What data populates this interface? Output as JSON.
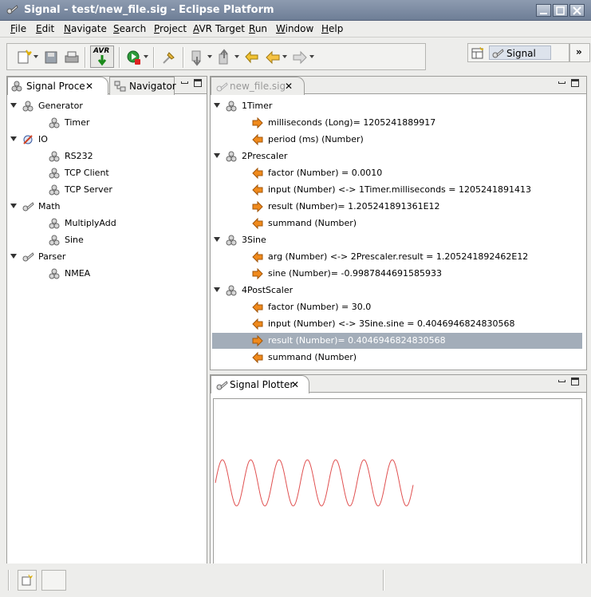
{
  "window": {
    "title": "Signal - test/new_file.sig - Eclipse Platform"
  },
  "menu": [
    "File",
    "Edit",
    "Navigate",
    "Search",
    "Project",
    "AVR Target",
    "Run",
    "Window",
    "Help"
  ],
  "menu_mnemonic": [
    "F",
    "E",
    "N",
    "S",
    "P",
    "A",
    "R",
    "W",
    "H"
  ],
  "toolbar": {
    "avr_label": "AVR"
  },
  "perspective": {
    "label": "Signal"
  },
  "left_panel": {
    "tabs": [
      {
        "label": "Signal Proce"
      },
      {
        "label": "Navigator"
      }
    ],
    "tree": [
      {
        "label": "Generator",
        "level": 0,
        "kind": "group"
      },
      {
        "label": "Timer",
        "level": 1,
        "kind": "component"
      },
      {
        "label": "IO",
        "level": 0,
        "kind": "io"
      },
      {
        "label": "RS232",
        "level": 1,
        "kind": "component"
      },
      {
        "label": "TCP Client",
        "level": 1,
        "kind": "component"
      },
      {
        "label": "TCP Server",
        "level": 1,
        "kind": "component"
      },
      {
        "label": "Math",
        "level": 0,
        "kind": "plug"
      },
      {
        "label": "MultiplyAdd",
        "level": 1,
        "kind": "component"
      },
      {
        "label": "Sine",
        "level": 1,
        "kind": "component"
      },
      {
        "label": "Parser",
        "level": 0,
        "kind": "plug"
      },
      {
        "label": "NMEA",
        "level": 1,
        "kind": "component"
      }
    ]
  },
  "editor": {
    "tab_label": "new_file.sig",
    "tree": [
      {
        "label": "1Timer",
        "level": 0,
        "kind": "group"
      },
      {
        "label": "milliseconds (Long)= 1205241889917",
        "level": 1,
        "kind": "out"
      },
      {
        "label": "period (ms) (Number)",
        "level": 1,
        "kind": "in"
      },
      {
        "label": "2Prescaler",
        "level": 0,
        "kind": "group"
      },
      {
        "label": "factor (Number) = 0.0010",
        "level": 1,
        "kind": "in"
      },
      {
        "label": "input (Number) <-> 1Timer.milliseconds = 1205241891413",
        "level": 1,
        "kind": "in"
      },
      {
        "label": "result (Number)= 1.205241891361E12",
        "level": 1,
        "kind": "out"
      },
      {
        "label": "summand (Number)",
        "level": 1,
        "kind": "in"
      },
      {
        "label": "3Sine",
        "level": 0,
        "kind": "group"
      },
      {
        "label": "arg (Number) <-> 2Prescaler.result = 1.205241892462E12",
        "level": 1,
        "kind": "in"
      },
      {
        "label": "sine (Number)= -0.9987844691585933",
        "level": 1,
        "kind": "out"
      },
      {
        "label": "4PostScaler",
        "level": 0,
        "kind": "group"
      },
      {
        "label": "factor (Number) = 30.0",
        "level": 1,
        "kind": "in"
      },
      {
        "label": "input (Number) <-> 3Sine.sine = 0.4046946824830568",
        "level": 1,
        "kind": "in"
      },
      {
        "label": "result (Number)= 0.4046946824830568",
        "level": 1,
        "kind": "out",
        "selected": true
      },
      {
        "label": "summand (Number)",
        "level": 1,
        "kind": "in"
      }
    ]
  },
  "plotter": {
    "tab_label": "Signal Plotter",
    "line_color": "#e05050",
    "periods_visible": 7
  },
  "colors": {
    "selection": "#a3adb9",
    "arrow_orange": "#f08a1c",
    "title_bar": "#7d8ca3"
  }
}
